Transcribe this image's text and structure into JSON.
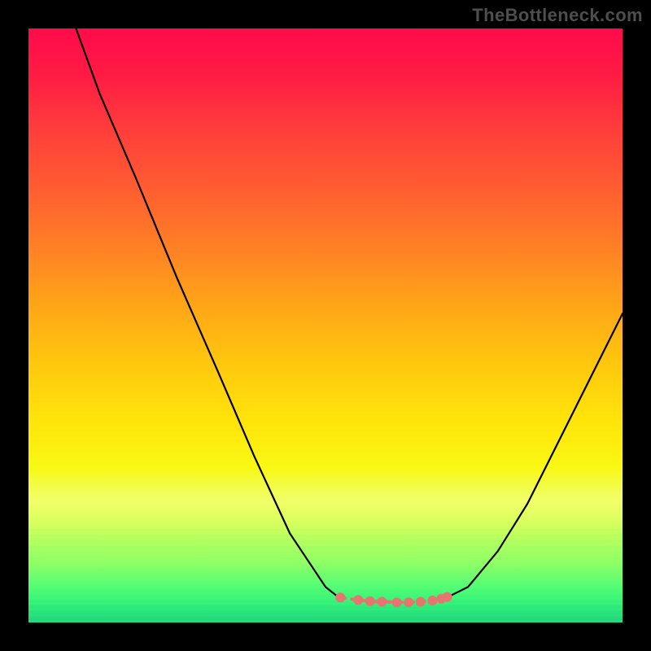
{
  "watermark": "TheBottleneck.com",
  "chart_data": {
    "type": "line",
    "title": "",
    "xlabel": "",
    "ylabel": "",
    "xlim": [
      0,
      100
    ],
    "ylim": [
      0,
      100
    ],
    "grid": false,
    "series": [
      {
        "name": "left-branch",
        "x": [
          8,
          12,
          18,
          25,
          32,
          38,
          44,
          50,
          52.5
        ],
        "values": [
          100,
          89,
          75,
          58,
          42,
          28,
          15,
          6,
          4
        ]
      },
      {
        "name": "right-branch",
        "x": [
          70,
          74,
          79,
          84,
          89,
          94,
          100
        ],
        "values": [
          4,
          6,
          12,
          20,
          30,
          40,
          52
        ]
      },
      {
        "name": "flat-zone-dots",
        "x": [
          52.5,
          55.5,
          57.5,
          59.5,
          62,
          64,
          66,
          68,
          69.5,
          70.5
        ],
        "values": [
          4.2,
          3.8,
          3.6,
          3.5,
          3.4,
          3.4,
          3.5,
          3.7,
          4.0,
          4.3
        ]
      }
    ],
    "styles": {
      "left-branch": {
        "stroke": "#000000",
        "width": 2.2
      },
      "right-branch": {
        "stroke": "#000000",
        "width": 2.2
      },
      "flat-zone-dots": {
        "fill": "#e4766f",
        "radius": 6,
        "dashed_line_stroke": "#e4766f"
      }
    },
    "background_gradient_stops": [
      {
        "pos": 0.0,
        "color": "#ff0b4a"
      },
      {
        "pos": 0.26,
        "color": "#ff5a32"
      },
      {
        "pos": 0.56,
        "color": "#ffc60e"
      },
      {
        "pos": 0.74,
        "color": "#f9f814"
      },
      {
        "pos": 0.9,
        "color": "#8cff63"
      },
      {
        "pos": 1.0,
        "color": "#1fd57c"
      }
    ]
  }
}
